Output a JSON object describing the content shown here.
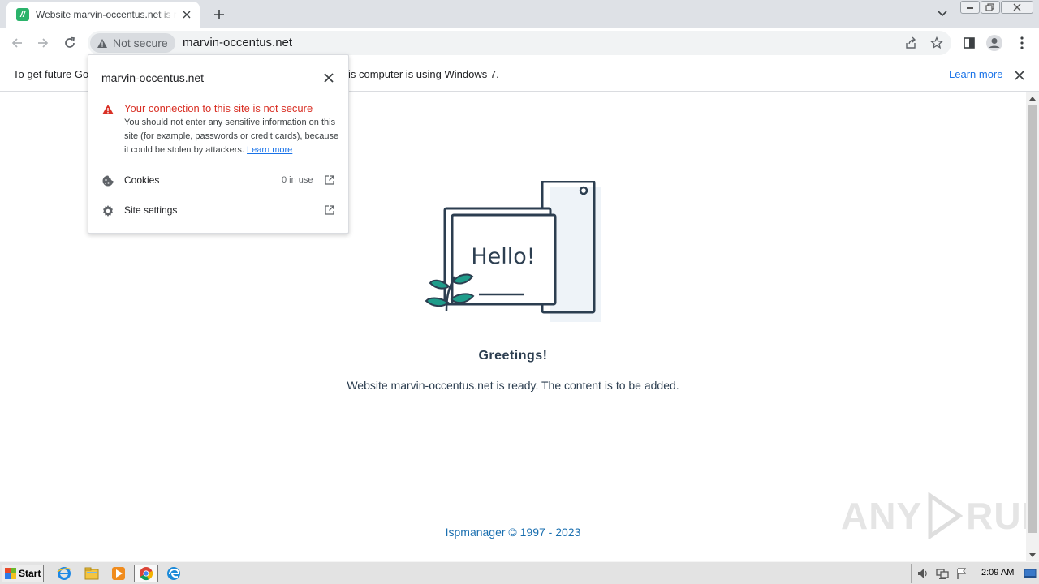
{
  "browser": {
    "tab": {
      "title": "Website marvin-occentus.net is ready. The content is to be added.",
      "favicon_glyph": "//"
    },
    "address_bar": {
      "security_label": "Not secure",
      "url": "marvin-occentus.net"
    }
  },
  "infobar": {
    "message_left": "To get future Go",
    "message_right": "is computer is using Windows 7.",
    "learn_more": "Learn more"
  },
  "site_info_popup": {
    "site": "marvin-occentus.net",
    "warning_title": "Your connection to this site is not secure",
    "warning_body": "You should not enter any sensitive information on this site (for example, passwords or credit cards), because it could be stolen by attackers.",
    "learn_more": "Learn more",
    "rows": [
      {
        "label": "Cookies",
        "meta": "0 in use",
        "icon": "cookie-icon"
      },
      {
        "label": "Site settings",
        "meta": "",
        "icon": "gear-icon"
      }
    ]
  },
  "page": {
    "hello": "Hello!",
    "greeting": "Greetings!",
    "ready_text": "Website marvin-occentus.net is ready. The content is to be added.",
    "footer": "Ispmanager © 1997 - 2023"
  },
  "watermark": {
    "left": "ANY",
    "right": "RUN"
  },
  "taskbar": {
    "start_label": "Start",
    "clock": "2:09 AM"
  },
  "colors": {
    "warning_red": "#d93025",
    "link_blue": "#1a73e8",
    "illustration_dark": "#2c3e50",
    "leaf_teal": "#1f9c8a"
  }
}
